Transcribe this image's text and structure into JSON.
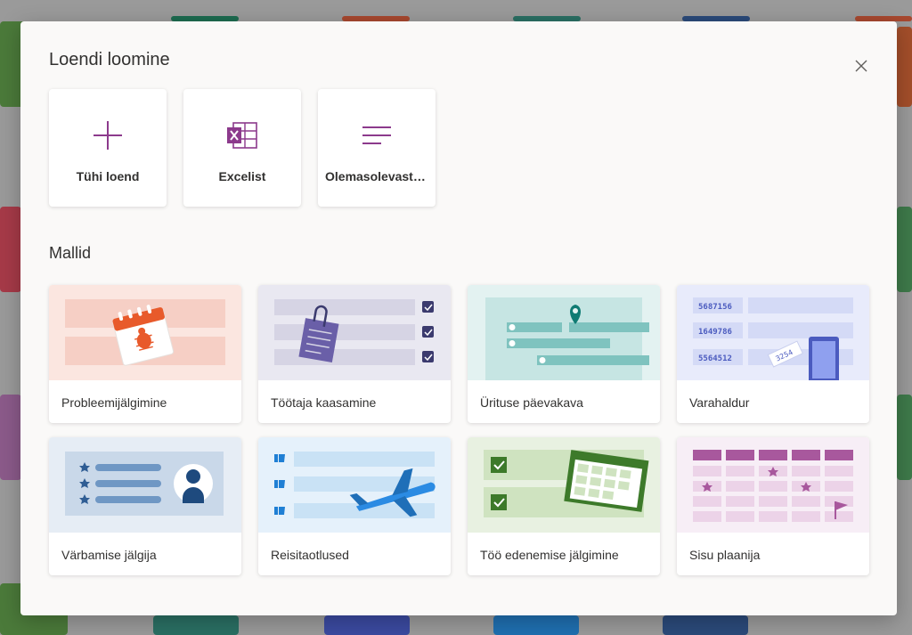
{
  "dialog": {
    "title": "Loendi loomine",
    "close_icon": "close-icon"
  },
  "create_options": [
    {
      "label": "Tühi loend",
      "icon": "plus-icon"
    },
    {
      "label": "Excelist",
      "icon": "excel-icon"
    },
    {
      "label": "Olemasolevast loendist",
      "icon": "list-lines-icon"
    }
  ],
  "templates_section": {
    "title": "Mallid",
    "items": [
      {
        "label": "Probleemijälgimine",
        "icon": "calendar-bug-icon"
      },
      {
        "label": "Töötaja kaasamine",
        "icon": "clipboard-checklist-icon"
      },
      {
        "label": "Ürituse päevakava",
        "icon": "location-pin-icon"
      },
      {
        "label": "Varahaldur",
        "icon": "asset-tag-icon",
        "thumb_values": [
          "5687156",
          "1649786",
          "5564512",
          "3254"
        ]
      },
      {
        "label": "Värbamise jälgija",
        "icon": "person-icon"
      },
      {
        "label": "Reisitaotlused",
        "icon": "airplane-icon"
      },
      {
        "label": "Töö edenemise jälgimine",
        "icon": "checkbox-calendar-icon"
      },
      {
        "label": "Sisu plaanija",
        "icon": "content-grid-icon"
      }
    ]
  },
  "colors": {
    "accent_purple": "#8c3a8c",
    "dialog_bg": "#faf9f8",
    "card_bg": "#ffffff"
  }
}
